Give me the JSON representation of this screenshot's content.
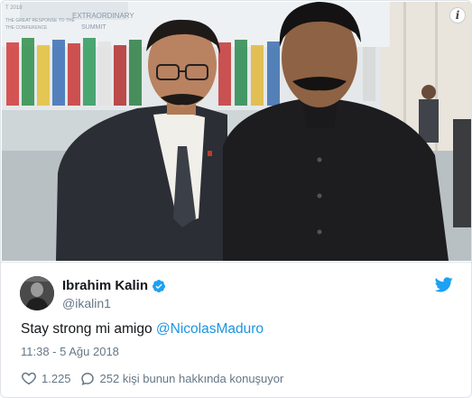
{
  "photo": {
    "banner_line1": "EXTRAORDINARY",
    "banner_line2": "SUMMIT",
    "banner_top_left": "T 2018",
    "banner_left": "THE GREAT RESPONSE TO THE",
    "banner_left2": "THE CONFERENCE",
    "info_label": "i"
  },
  "tweet": {
    "author_name": "Ibrahim Kalin",
    "author_handle": "@ikalin1",
    "text_prefix": "Stay strong mi amigo ",
    "mention": "@NicolasMaduro",
    "timestamp": "11:38 - 5 Ağu 2018",
    "likes_count": "1.225",
    "replies_text": "252 kişi bunun hakkında konuşuyor"
  },
  "colors": {
    "link": "#1b95e0",
    "verified_badge": "#1da1f2",
    "twitter_bird": "#1da1f2",
    "muted_text": "#657786"
  },
  "icons": {
    "info": "info-icon",
    "verified": "verified-badge-icon",
    "brand": "twitter-bird-icon",
    "like": "heart-icon",
    "reply": "speech-bubble-icon"
  }
}
